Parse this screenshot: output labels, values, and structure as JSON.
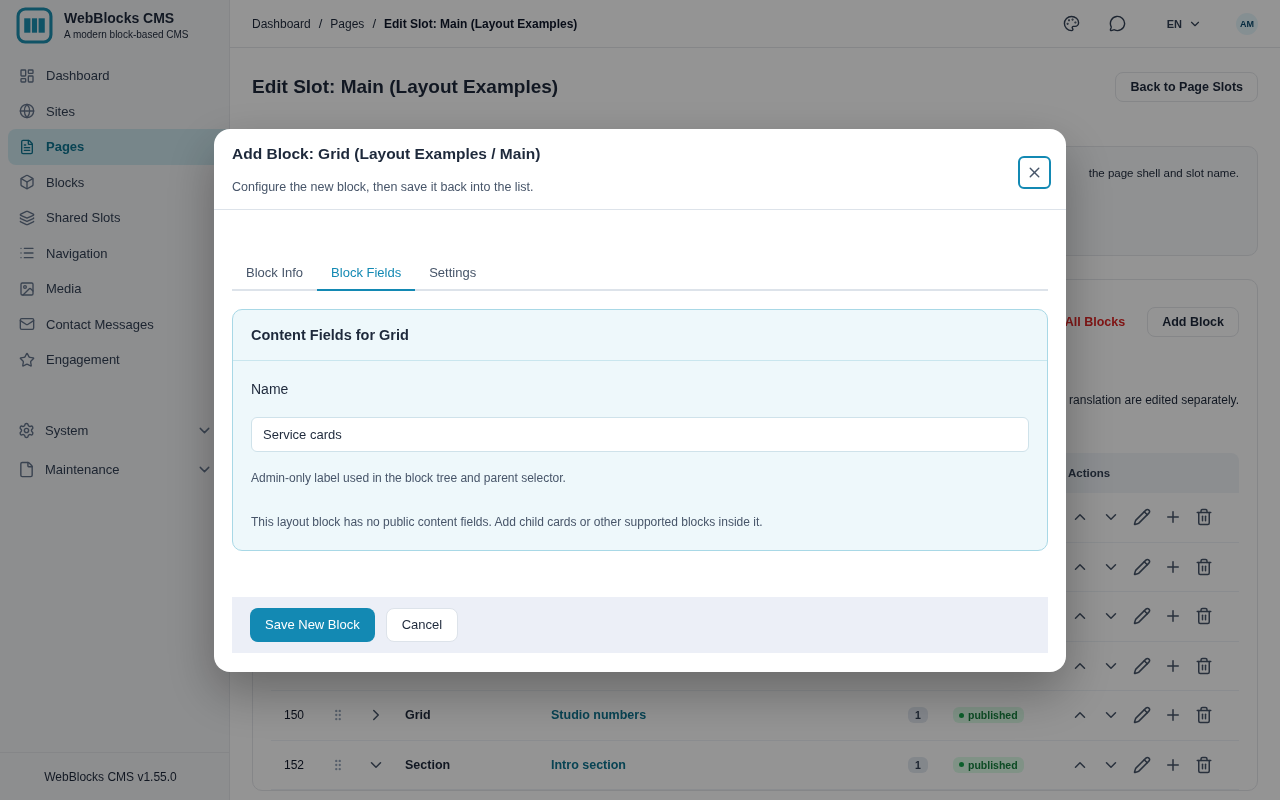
{
  "sidebar": {
    "brand": "WebBlocks CMS",
    "tagline": "A modern block-based CMS",
    "items": [
      {
        "label": "Dashboard",
        "selected": false
      },
      {
        "label": "Sites",
        "selected": false
      },
      {
        "label": "Pages",
        "selected": true
      },
      {
        "label": "Blocks",
        "selected": false
      },
      {
        "label": "Shared Slots",
        "selected": false
      },
      {
        "label": "Navigation",
        "selected": false
      },
      {
        "label": "Media",
        "selected": false
      },
      {
        "label": "Contact Messages",
        "selected": false
      },
      {
        "label": "Engagement",
        "selected": false
      }
    ],
    "groups": [
      {
        "label": "System",
        "expanded": false
      },
      {
        "label": "Maintenance",
        "expanded": false
      }
    ],
    "footer": "WebBlocks CMS v1.55.0"
  },
  "header": {
    "separator": "/",
    "breadcrumbs": [
      "Dashboard",
      "Pages",
      "Edit Slot: Main (Layout Examples)"
    ],
    "language": "EN",
    "avatar": "AM"
  },
  "page": {
    "title": "Edit Slot: Main (Layout Examples)",
    "back_button": "Back to Page Slots",
    "info_text": "the page shell and slot name.",
    "blocks": {
      "delete_link": "All Blocks",
      "add_button": "Add Block",
      "note": "ranslation are edited separately.",
      "columns": [
        "Actions"
      ],
      "rows": [
        {},
        {},
        {},
        {},
        {
          "id": "150",
          "expanded": false,
          "type": "Grid",
          "name": "Studio numbers",
          "count": "1",
          "status": "published"
        },
        {
          "id": "152",
          "expanded": true,
          "type": "Section",
          "name": "Intro section",
          "count": "1",
          "status": "published"
        }
      ]
    }
  },
  "modal": {
    "title": "Add Block: Grid (Layout Examples / Main)",
    "subtitle": "Configure the new block, then save it back into the list.",
    "tabs": [
      {
        "label": "Block Info",
        "selected": false
      },
      {
        "label": "Block Fields",
        "selected": true
      },
      {
        "label": "Settings",
        "selected": false
      }
    ],
    "panel_title": "Content Fields for Grid",
    "field_label": "Name",
    "field_value": "Service cards",
    "help": "Admin-only label used in the block tree and parent selector.",
    "note": "This layout block has no public content fields. Add child cards or other supported blocks inside it.",
    "save_button": "Save New Block",
    "cancel_button": "Cancel"
  }
}
